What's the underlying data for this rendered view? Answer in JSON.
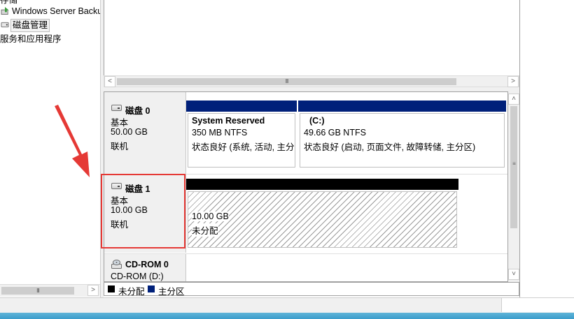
{
  "tree": {
    "items": [
      {
        "label": "存储",
        "icon": "storage-icon"
      },
      {
        "label": "Windows Server Backup",
        "icon": "backup-icon"
      },
      {
        "label": "磁盘管理",
        "icon": "disk-management-icon",
        "selected": true
      },
      {
        "label": "服务和应用程序",
        "icon": "services-icon"
      }
    ]
  },
  "disks": [
    {
      "title": "磁盘 0",
      "type": "基本",
      "size": "50.00 GB",
      "status": "联机",
      "partitions": [
        {
          "name": "System Reserved",
          "info": "350 MB NTFS",
          "status": "状态良好 (系统, 活动, 主分区)",
          "kind": "primary"
        },
        {
          "name": "(C:)",
          "info": "49.66 GB NTFS",
          "status": "状态良好 (启动, 页面文件, 故障转储, 主分区)",
          "kind": "primary"
        }
      ]
    },
    {
      "title": "磁盘 1",
      "type": "基本",
      "size": "10.00 GB",
      "status": "联机",
      "highlighted": true,
      "partitions": [
        {
          "name": "",
          "info": "10.00 GB",
          "status": "未分配",
          "kind": "unallocated"
        }
      ]
    },
    {
      "title": "CD-ROM 0",
      "type": "CD-ROM (D:)"
    }
  ],
  "legend": [
    {
      "label": "未分配",
      "color": "#000000"
    },
    {
      "label": "主分区",
      "color": "#00207a"
    }
  ],
  "colors": {
    "primary_bar": "#00207a",
    "unallocated_bar": "#000000",
    "highlight": "#e53935"
  }
}
